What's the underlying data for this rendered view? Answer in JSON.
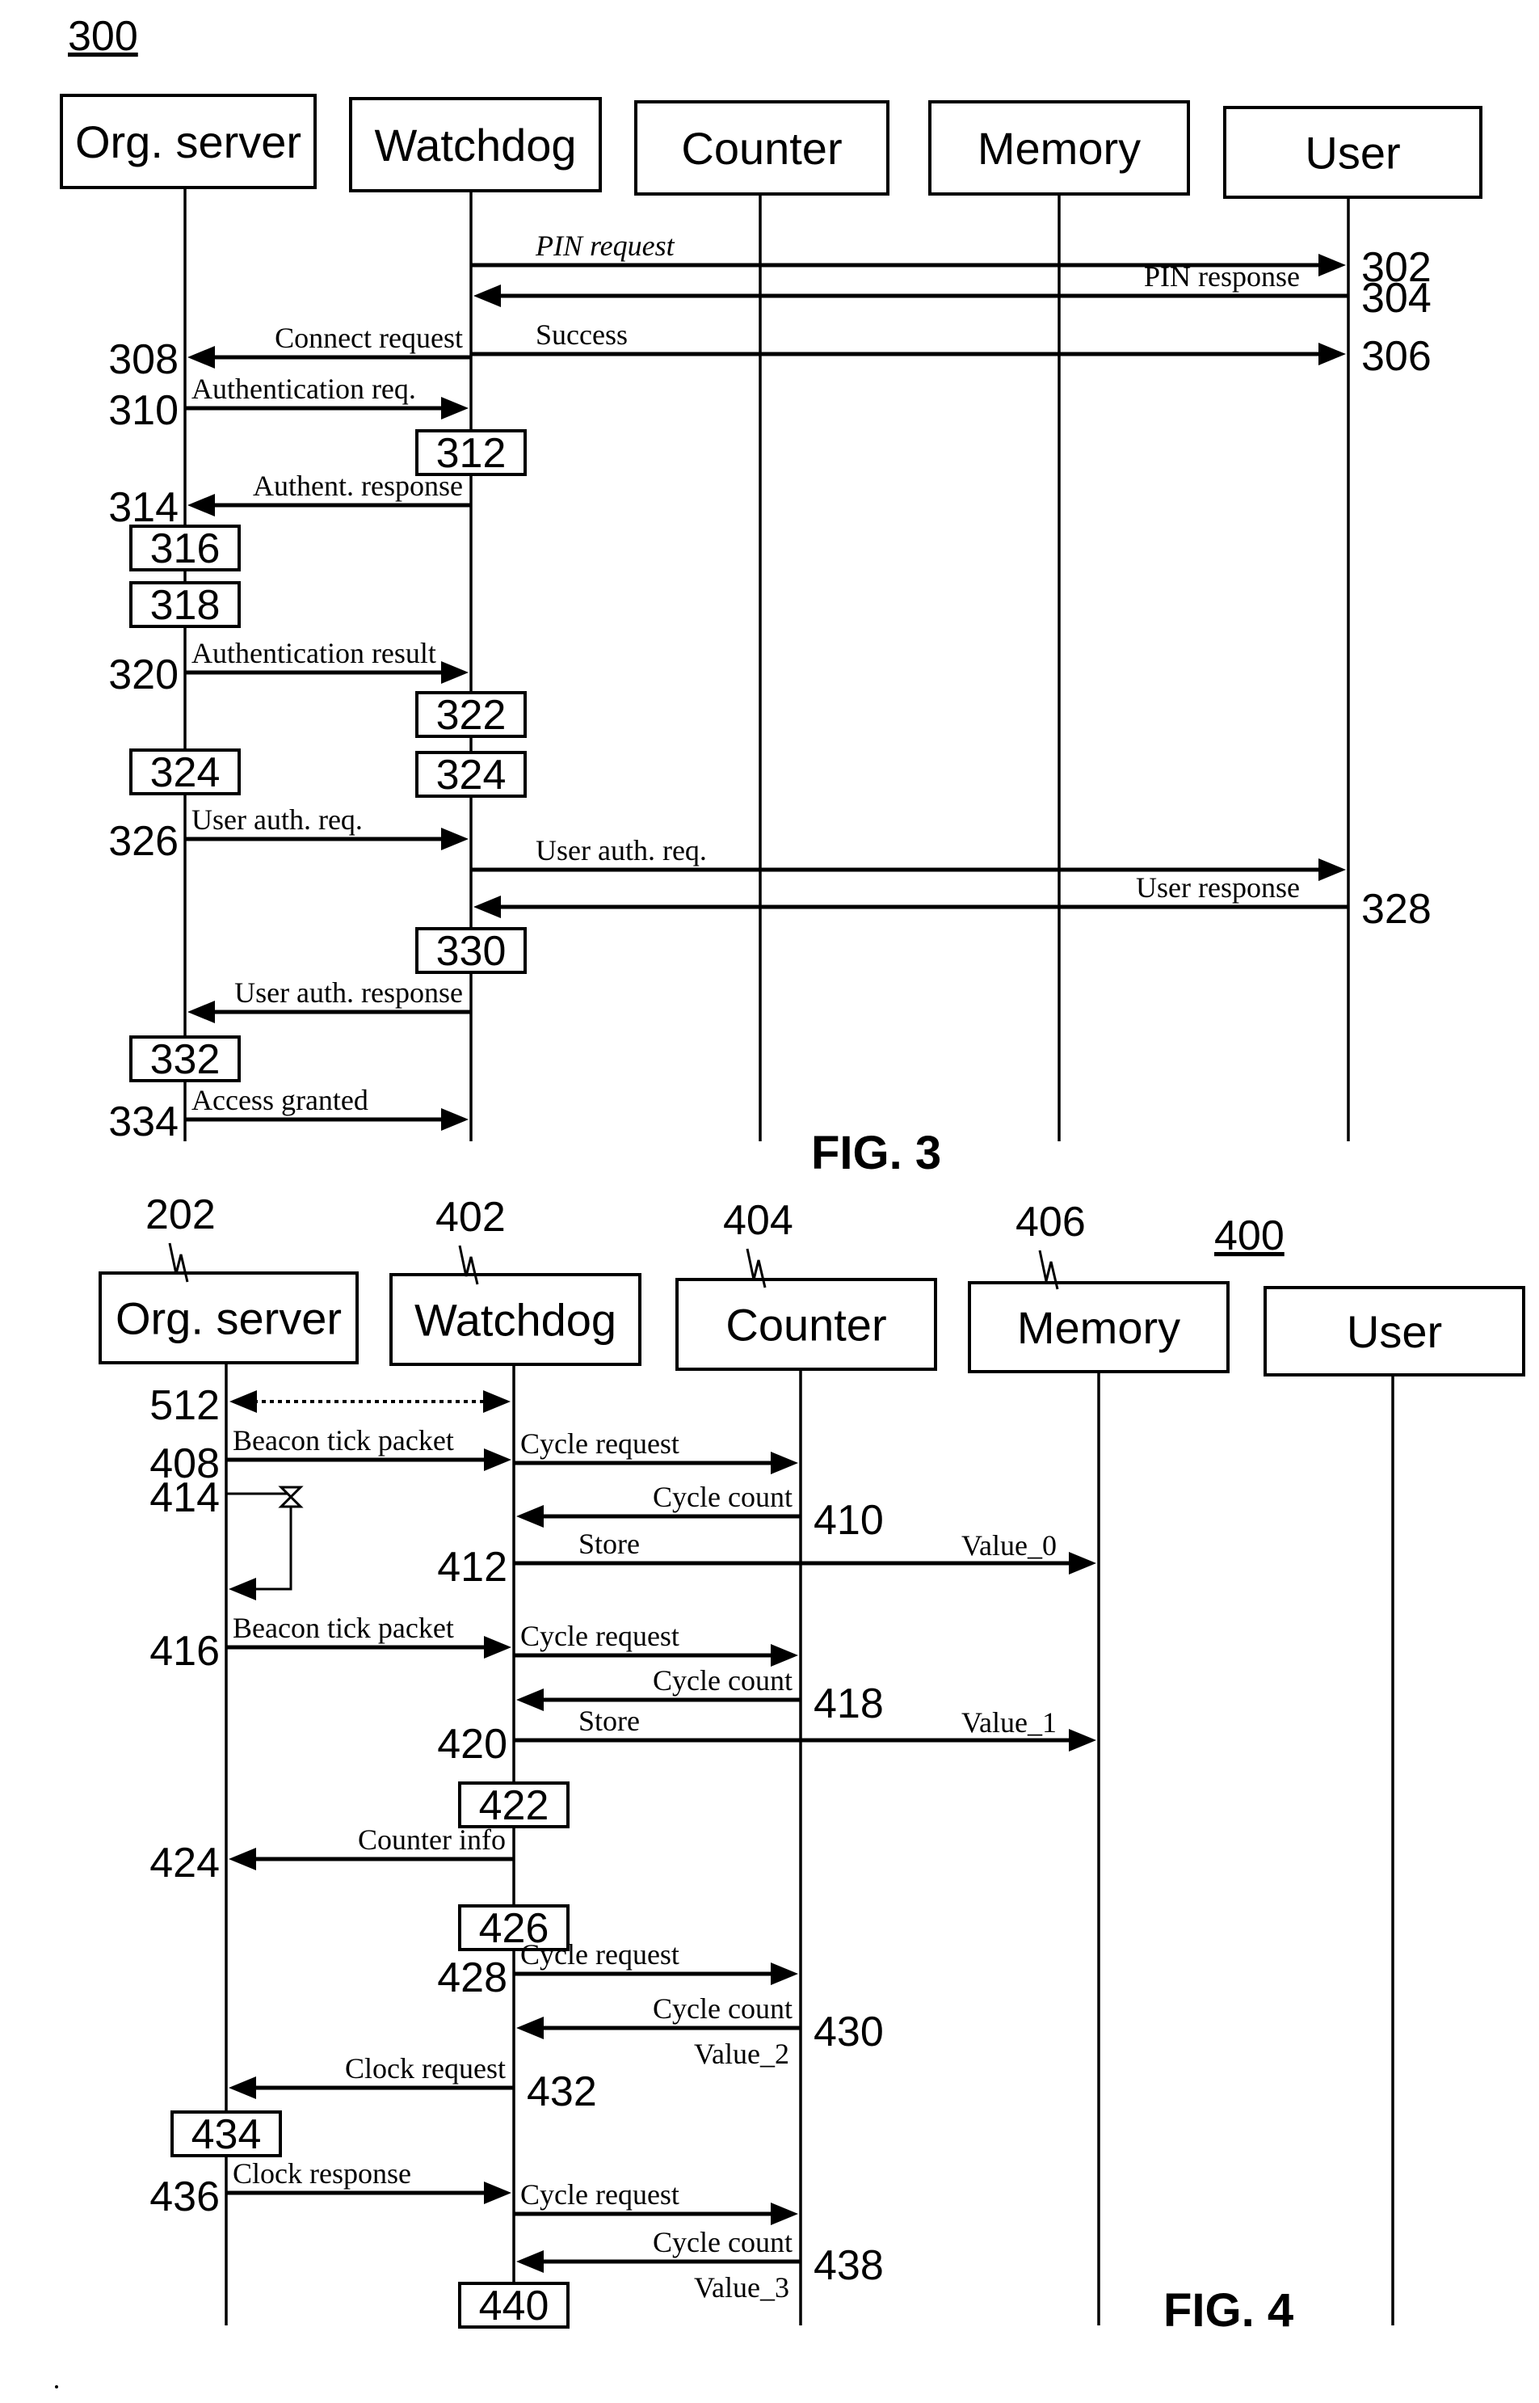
{
  "figures": [
    {
      "id": "fig3",
      "reference": "300",
      "caption": "FIG. 3",
      "participants": [
        {
          "key": "org",
          "label": "Org. server",
          "ref": ""
        },
        {
          "key": "wd",
          "label": "Watchdog",
          "ref": ""
        },
        {
          "key": "ctr",
          "label": "Counter",
          "ref": ""
        },
        {
          "key": "mem",
          "label": "Memory",
          "ref": ""
        },
        {
          "key": "user",
          "label": "User",
          "ref": ""
        }
      ],
      "steps": [
        {
          "type": "message",
          "from": "wd",
          "to": "user",
          "label": "PIN request",
          "italic": true,
          "number": "302",
          "number_side": "right"
        },
        {
          "type": "message",
          "from": "user",
          "to": "wd",
          "label": "PIN response",
          "number": "304",
          "number_side": "right"
        },
        {
          "type": "message",
          "from": "wd",
          "to": "user",
          "label": "Success",
          "number": "306",
          "number_side": "right"
        },
        {
          "type": "message",
          "from": "wd",
          "to": "org",
          "label": "Connect request",
          "number": "308",
          "number_side": "left"
        },
        {
          "type": "message",
          "from": "org",
          "to": "wd",
          "label": "Authentication req.",
          "number": "310",
          "number_side": "left"
        },
        {
          "type": "process",
          "on": "wd",
          "label": "312"
        },
        {
          "type": "message",
          "from": "wd",
          "to": "org",
          "label": "Authent. response",
          "number": "314",
          "number_side": "left"
        },
        {
          "type": "process",
          "on": "org",
          "label": "316"
        },
        {
          "type": "process",
          "on": "org",
          "label": "318"
        },
        {
          "type": "message",
          "from": "org",
          "to": "wd",
          "label": "Authentication result",
          "number": "320",
          "number_side": "left"
        },
        {
          "type": "process",
          "on": "wd",
          "label": "322"
        },
        {
          "type": "process",
          "on": "org",
          "label": "324"
        },
        {
          "type": "process",
          "on": "wd",
          "label": "324"
        },
        {
          "type": "message",
          "from": "org",
          "to": "wd",
          "label": "User auth. req.",
          "number": "326",
          "number_side": "left"
        },
        {
          "type": "message",
          "from": "wd",
          "to": "user",
          "label": "User auth. req."
        },
        {
          "type": "message",
          "from": "user",
          "to": "wd",
          "label": "User response",
          "number": "328",
          "number_side": "right"
        },
        {
          "type": "process",
          "on": "wd",
          "label": "330"
        },
        {
          "type": "message",
          "from": "wd",
          "to": "org",
          "label": "User auth. response"
        },
        {
          "type": "process",
          "on": "org",
          "label": "332"
        },
        {
          "type": "message",
          "from": "org",
          "to": "wd",
          "label": "Access granted",
          "number": "334",
          "number_side": "left"
        }
      ]
    },
    {
      "id": "fig4",
      "reference": "400",
      "caption": "FIG. 4",
      "participants": [
        {
          "key": "org",
          "label": "Org. server",
          "ref": "202"
        },
        {
          "key": "wd",
          "label": "Watchdog",
          "ref": "402"
        },
        {
          "key": "ctr",
          "label": "Counter",
          "ref": "404"
        },
        {
          "key": "mem",
          "label": "Memory",
          "ref": "406"
        },
        {
          "key": "user",
          "label": "User",
          "ref": ""
        }
      ],
      "steps": [
        {
          "type": "sync",
          "from": "org",
          "to": "wd",
          "label": "",
          "number": "512",
          "number_side": "left",
          "style": "dashed-bidirectional"
        },
        {
          "type": "message",
          "from": "org",
          "to": "wd",
          "label": "Beacon tick packet",
          "number": "408",
          "number_side": "left"
        },
        {
          "type": "message",
          "from": "wd",
          "to": "ctr",
          "label": "Cycle request"
        },
        {
          "type": "timeout",
          "on": "org",
          "label": "",
          "number": "414",
          "number_side": "left"
        },
        {
          "type": "message",
          "from": "ctr",
          "to": "wd",
          "label": "Cycle count",
          "number": "410",
          "number_side": "right"
        },
        {
          "type": "message",
          "from": "wd",
          "to": "mem",
          "label": "Store",
          "sublabel": "Value_0",
          "number": "412",
          "number_side": "left"
        },
        {
          "type": "message",
          "from": "org",
          "to": "wd",
          "label": "Beacon tick packet",
          "number": "416",
          "number_side": "left"
        },
        {
          "type": "message",
          "from": "wd",
          "to": "ctr",
          "label": "Cycle request"
        },
        {
          "type": "message",
          "from": "ctr",
          "to": "wd",
          "label": "Cycle count",
          "number": "418",
          "number_side": "right"
        },
        {
          "type": "message",
          "from": "wd",
          "to": "mem",
          "label": "Store",
          "sublabel": "Value_1",
          "number": "420",
          "number_side": "left"
        },
        {
          "type": "process",
          "on": "wd",
          "label": "422"
        },
        {
          "type": "message",
          "from": "wd",
          "to": "org",
          "label": "Counter info",
          "number": "424",
          "number_side": "left"
        },
        {
          "type": "process",
          "on": "wd",
          "label": "426"
        },
        {
          "type": "message",
          "from": "wd",
          "to": "ctr",
          "label": "Cycle request",
          "number": "428",
          "number_side": "left"
        },
        {
          "type": "message",
          "from": "ctr",
          "to": "wd",
          "label": "Cycle count",
          "sublabel": "Value_2",
          "number": "430",
          "number_side": "right"
        },
        {
          "type": "message",
          "from": "wd",
          "to": "org",
          "label": "Clock request",
          "number": "432",
          "number_side": "right"
        },
        {
          "type": "process",
          "on": "org",
          "label": "434"
        },
        {
          "type": "message",
          "from": "org",
          "to": "wd",
          "label": "Clock response",
          "number": "436",
          "number_side": "left"
        },
        {
          "type": "message",
          "from": "wd",
          "to": "ctr",
          "label": "Cycle request"
        },
        {
          "type": "message",
          "from": "ctr",
          "to": "wd",
          "label": "Cycle count",
          "sublabel": "Value_3",
          "number": "438",
          "number_side": "right"
        },
        {
          "type": "process",
          "on": "wd",
          "label": "440"
        }
      ]
    }
  ]
}
